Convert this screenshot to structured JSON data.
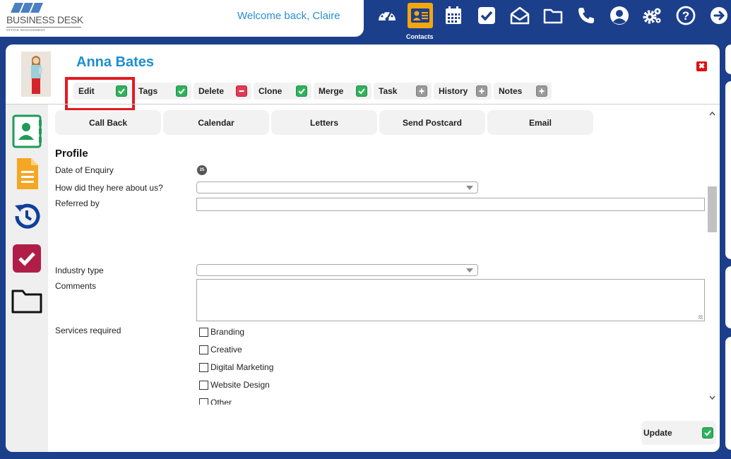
{
  "header": {
    "brand_name": "BUSINESS DESK",
    "brand_tagline": "OFFICE MANAGEMENT",
    "welcome": "Welcome back, Claire",
    "active_label": "Contacts",
    "nav_icons": [
      "dashboard-icon",
      "contacts-icon",
      "calendar-icon",
      "tasks-icon",
      "mail-icon",
      "folder-icon",
      "phone-icon",
      "user-icon",
      "settings-icon",
      "help-icon",
      "logout-icon"
    ]
  },
  "contact": {
    "name": "Anna Bates",
    "close_glyph": "✖"
  },
  "actions": [
    {
      "label": "Edit",
      "badge": "check"
    },
    {
      "label": "Tags",
      "badge": "check"
    },
    {
      "label": "Delete",
      "badge": "minus"
    },
    {
      "label": "Clone",
      "badge": "check"
    },
    {
      "label": "Merge",
      "badge": "check"
    },
    {
      "label": "Task",
      "badge": "plus"
    },
    {
      "label": "History",
      "badge": "plus"
    },
    {
      "label": "Notes",
      "badge": "plus"
    }
  ],
  "subtabs": [
    "Call Back",
    "Calendar",
    "Letters",
    "Send Postcard",
    "Email"
  ],
  "sidebar_icons": [
    "contact-card-icon",
    "document-icon",
    "history-icon",
    "checkbox-icon",
    "folder-icon"
  ],
  "profile": {
    "title": "Profile",
    "date_of_enquiry_label": "Date of Enquiry",
    "date_icon_text": "25",
    "heard_about_label": "How did they here about us?",
    "heard_about_value": "",
    "referred_by_label": "Referred by",
    "referred_by_value": "",
    "industry_label": "Industry type",
    "industry_value": "",
    "comments_label": "Comments",
    "comments_value": "",
    "services_label": "Services required",
    "services": [
      {
        "label": "Branding",
        "checked": false
      },
      {
        "label": "Creative",
        "checked": false
      },
      {
        "label": "Digital Marketing",
        "checked": false
      },
      {
        "label": "Website Design",
        "checked": false
      },
      {
        "label": "Other",
        "checked": false
      }
    ]
  },
  "update_label": "Update",
  "colors": {
    "nav_bg": "#1c3f8c",
    "accent_blue": "#1c8fd0",
    "active_orange": "#f2a60f",
    "badge_green": "#2fb25b",
    "badge_red": "#e23a54",
    "badge_gray": "#9a9a9a",
    "highlight_red": "#e21a22"
  }
}
